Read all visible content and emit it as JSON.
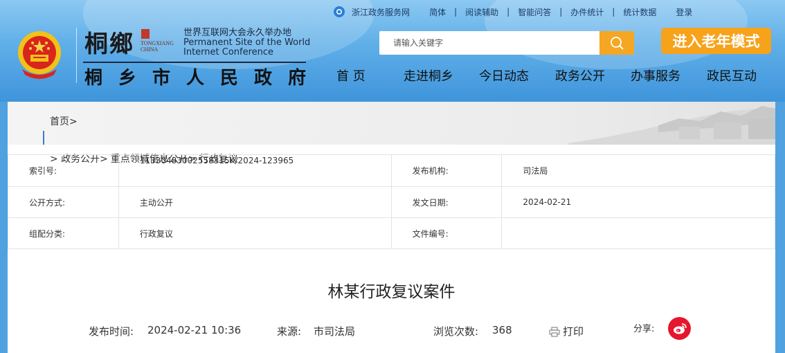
{
  "top_links": {
    "portal": "浙江政务服务网",
    "items": [
      "简体",
      "阅读辅助",
      "智能问答",
      "办件统计",
      "统计数据",
      "登录"
    ],
    "separator": "|"
  },
  "brand": {
    "calligraphy": "桐鄉",
    "seal_line1": "TONGXIANG",
    "seal_line2": "CHINA",
    "wic_cn": "世界互联网大会永久举办地",
    "wic_en1": "Permanent Site of the World",
    "wic_en2": "Internet Conference",
    "gov_name": "桐乡市人民政府"
  },
  "search": {
    "placeholder": "请输入关键字",
    "icon": "search-icon"
  },
  "elder_mode": {
    "label": "进入老年模式",
    "color": "#f7a21b"
  },
  "nav": [
    "首 页",
    "走进桐乡",
    "今日动态",
    "政务公开",
    "办事服务",
    "政民互动"
  ],
  "breadcrumb": {
    "home": "首页>",
    "path": [
      "> 政务公开>",
      "重点领域信息公开>",
      "行政复议"
    ]
  },
  "meta": {
    "index_label": "索引号:",
    "index_value": "11330483002558315K/2024-123965",
    "issuer_label": "发布机构:",
    "issuer_value": "司法局",
    "open_label": "公开方式:",
    "open_value": "主动公开",
    "date_label": "发文日期:",
    "date_value": "2024-02-21",
    "category_label": "组配分类:",
    "category_value": "行政复议",
    "docno_label": "文件编号:",
    "docno_value": ""
  },
  "article": {
    "title": "林某行政复议案件",
    "publish_label": "发布时间:",
    "publish_date": "2024-02-21",
    "publish_time": "10:36",
    "source_label": "来源:",
    "source_value": "市司法局",
    "views_label": "浏览次数:",
    "views_value": "368",
    "print_label": "打印",
    "share_label": "分享:"
  },
  "colors": {
    "banner": "#4fa1df",
    "accent_orange": "#f5a623",
    "weibo_red": "#e6162d"
  }
}
